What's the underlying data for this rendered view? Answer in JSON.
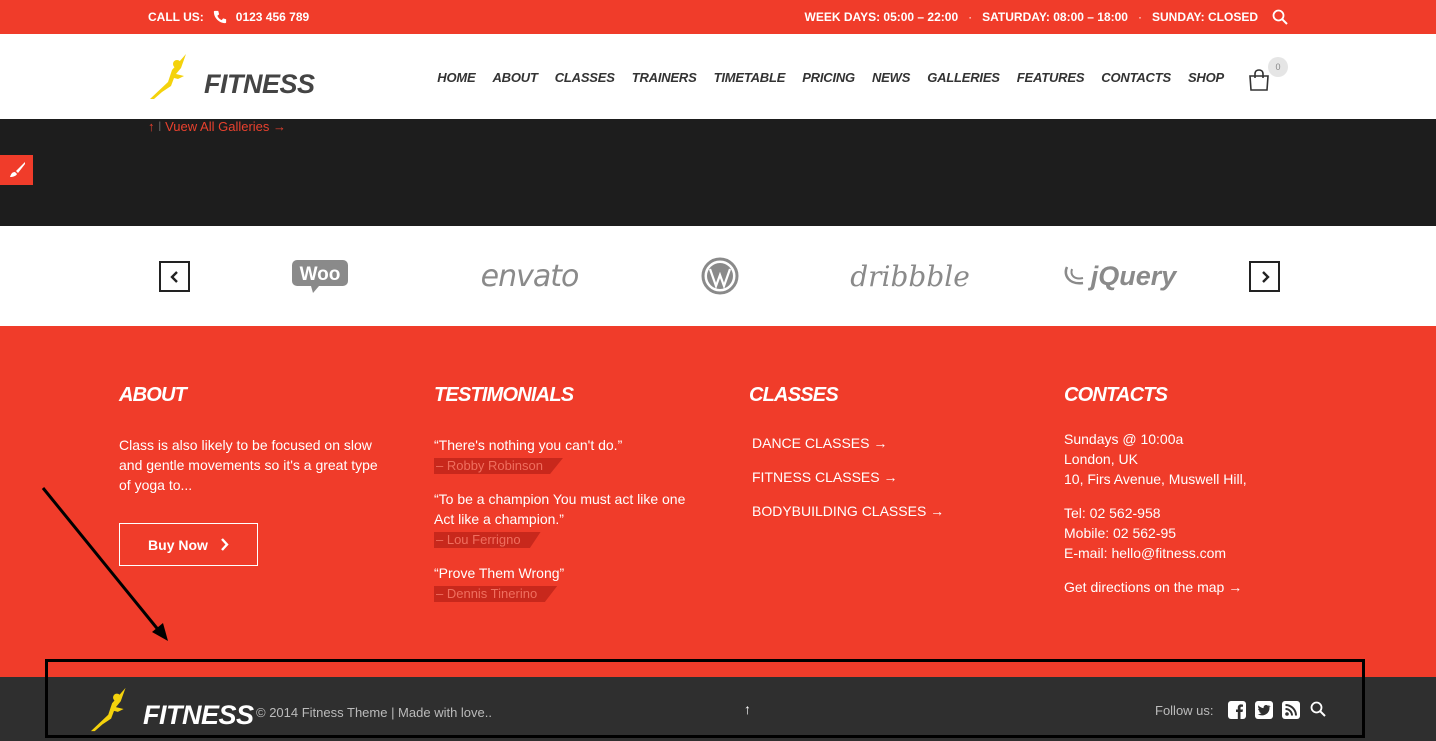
{
  "topbar": {
    "call_label": "CALL US:",
    "phone": "0123 456 789",
    "weekdays": "WEEK DAYS: 05:00 – 22:00",
    "saturday": "SATURDAY: 08:00 – 18:00",
    "sunday": "SUNDAY: CLOSED",
    "separator": "·"
  },
  "header": {
    "logo_text": "FITNESS",
    "nav": [
      "HOME",
      "ABOUT",
      "CLASSES",
      "TRAINERS",
      "TIMETABLE",
      "PRICING",
      "NEWS",
      "GALLERIES",
      "FEATURES",
      "CONTACTS",
      "SHOP"
    ],
    "cart_count": "0"
  },
  "gallery_nav": {
    "up_arrow": "↑",
    "separator": "|",
    "link": "Vuew All Galleries →"
  },
  "partners": [
    "Woo",
    "envato",
    "WordPress",
    "dribbble",
    "jQuery"
  ],
  "footer": {
    "about": {
      "title": "ABOUT",
      "text": "Class is also likely to be focused on slow and gentle movements so it's a great type of yoga to...",
      "button": "Buy Now"
    },
    "testimonials": {
      "title": "TESTIMONIALS",
      "items": [
        {
          "quote": "“There's nothing you can't do.”",
          "author": "– Robby Robinson"
        },
        {
          "quote": "“To be a champion You must act like one Act like a champion.”",
          "author": "– Lou Ferrigno"
        },
        {
          "quote": "“Prove Them Wrong”",
          "author": "– Dennis Tinerino"
        }
      ]
    },
    "classes": {
      "title": "CLASSES",
      "items": [
        "DANCE CLASSES →",
        "FITNESS CLASSES →",
        "BODYBUILDING CLASSES →"
      ]
    },
    "contacts": {
      "title": "CONTACTS",
      "address": [
        "Sundays @ 10:00a",
        "London, UK",
        "10, Firs Avenue, Muswell Hill,"
      ],
      "phones": [
        "Tel: 02 562-958",
        "Mobile: 02 562-95",
        "E-mail: hello@fitness.com"
      ],
      "map_link": "Get directions on the map →"
    }
  },
  "bottom": {
    "logo_text": "FITNESS",
    "copyright": "© 2014 Fitness Theme | Made with love..",
    "up_arrow": "↑",
    "follow_label": "Follow us:",
    "social_icons": [
      "facebook-icon",
      "twitter-icon",
      "rss-icon",
      "search-icon"
    ]
  },
  "colors": {
    "brand_red": "#f03c2a",
    "dark": "#1d1d1d",
    "footer_dark": "#2f2f2f",
    "logo_yellow": "#f4d20c"
  }
}
